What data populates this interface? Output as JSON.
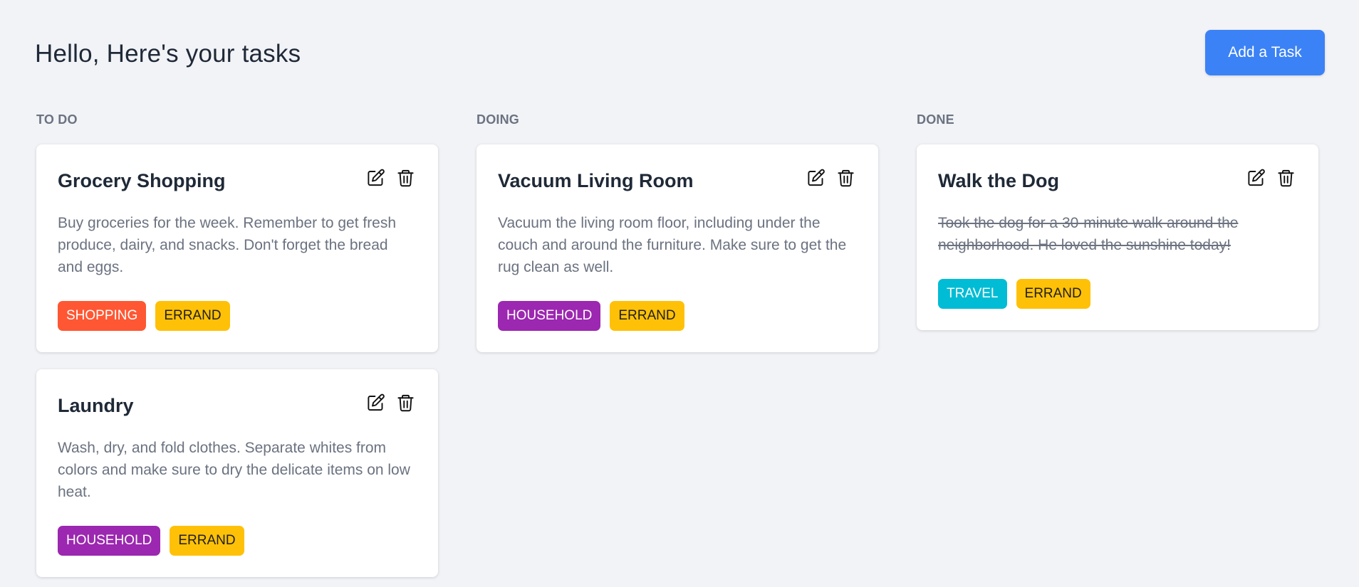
{
  "header": {
    "title": "Hello, Here's your tasks",
    "add_button_label": "Add a Task"
  },
  "columns": [
    {
      "title": "TO DO",
      "cards": [
        {
          "title": "Grocery Shopping",
          "description": "Buy groceries for the week. Remember to get fresh produce, dairy, and snacks. Don't forget the bread and eggs.",
          "completed": false,
          "tags": [
            {
              "label": "SHOPPING",
              "bg": "#ff5733",
              "fg": "#ffffff"
            },
            {
              "label": "ERRAND",
              "bg": "#ffc107",
              "fg": "#1f1f1f"
            }
          ]
        },
        {
          "title": "Laundry",
          "description": "Wash, dry, and fold clothes. Separate whites from colors and make sure to dry the delicate items on low heat.",
          "completed": false,
          "tags": [
            {
              "label": "HOUSEHOLD",
              "bg": "#9c27b0",
              "fg": "#ffffff"
            },
            {
              "label": "ERRAND",
              "bg": "#ffc107",
              "fg": "#1f1f1f"
            }
          ]
        }
      ]
    },
    {
      "title": "DOING",
      "cards": [
        {
          "title": "Vacuum Living Room",
          "description": "Vacuum the living room floor, including under the couch and around the furniture. Make sure to get the rug clean as well.",
          "completed": false,
          "tags": [
            {
              "label": "HOUSEHOLD",
              "bg": "#9c27b0",
              "fg": "#ffffff"
            },
            {
              "label": "ERRAND",
              "bg": "#ffc107",
              "fg": "#1f1f1f"
            }
          ]
        }
      ]
    },
    {
      "title": "DONE",
      "cards": [
        {
          "title": "Walk the Dog",
          "description": "Took the dog for a 30-minute walk around the neighborhood. He loved the sunshine today!",
          "completed": true,
          "tags": [
            {
              "label": "TRAVEL",
              "bg": "#00bcd4",
              "fg": "#ffffff"
            },
            {
              "label": "ERRAND",
              "bg": "#ffc107",
              "fg": "#1f1f1f"
            }
          ]
        }
      ]
    }
  ],
  "icons": {
    "edit": "edit-icon",
    "delete": "trash-icon"
  },
  "colors": {
    "accent": "#3b82f6",
    "background": "#f2f3f7"
  }
}
